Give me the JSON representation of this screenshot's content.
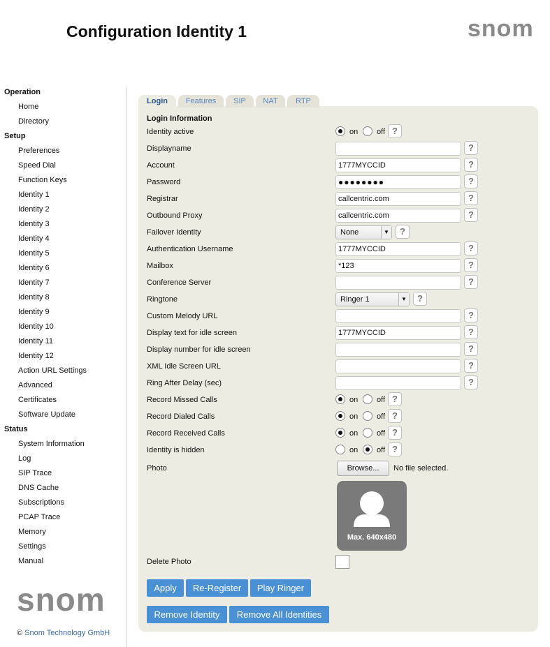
{
  "header": {
    "title": "Configuration Identity 1",
    "logo_text": "snom"
  },
  "sidebar": {
    "sections": [
      {
        "title": "Operation",
        "items": [
          "Home",
          "Directory"
        ]
      },
      {
        "title": "Setup",
        "items": [
          "Preferences",
          "Speed Dial",
          "Function Keys",
          "Identity 1",
          "Identity 2",
          "Identity 3",
          "Identity 4",
          "Identity 5",
          "Identity 6",
          "Identity 7",
          "Identity 8",
          "Identity 9",
          "Identity 10",
          "Identity 11",
          "Identity 12",
          "Action URL Settings",
          "Advanced",
          "Certificates",
          "Software Update"
        ]
      },
      {
        "title": "Status",
        "items": [
          "System Information",
          "Log",
          "SIP Trace",
          "DNS Cache",
          "Subscriptions",
          "PCAP Trace",
          "Memory",
          "Settings",
          "Manual"
        ]
      }
    ],
    "logo_text": "snom",
    "copyright_symbol": "©",
    "copyright_link": "Snom Technology GmbH"
  },
  "tabs": [
    "Login",
    "Features",
    "SIP",
    "NAT",
    "RTP"
  ],
  "form": {
    "section_title": "Login Information",
    "radio_on_label": "on",
    "radio_off_label": "off",
    "help_symbol": "?",
    "labels": {
      "identity_active": "Identity active",
      "displayname": "Displayname",
      "account": "Account",
      "password": "Password",
      "registrar": "Registrar",
      "outbound_proxy": "Outbound Proxy",
      "failover_identity": "Failover Identity",
      "auth_username": "Authentication Username",
      "mailbox": "Mailbox",
      "conference_server": "Conference Server",
      "ringtone": "Ringtone",
      "custom_melody_url": "Custom Melody URL",
      "display_text_idle": "Display text for idle screen",
      "display_number_idle": "Display number for idle screen",
      "xml_idle_url": "XML Idle Screen URL",
      "ring_after_delay": "Ring After Delay (sec)",
      "record_missed": "Record Missed Calls",
      "record_dialed": "Record Dialed Calls",
      "record_received": "Record Received Calls",
      "identity_hidden": "Identity is hidden",
      "photo": "Photo",
      "delete_photo": "Delete Photo"
    },
    "values": {
      "identity_active": "on",
      "displayname": "",
      "account": "1777MYCCID",
      "password": "●●●●●●●●",
      "registrar": "callcentric.com",
      "outbound_proxy": "callcentric.com",
      "failover_identity": "None",
      "auth_username": "1777MYCCID",
      "mailbox": "*123",
      "conference_server": "",
      "ringtone": "Ringer 1",
      "custom_melody_url": "",
      "display_text_idle": "1777MYCCID",
      "display_number_idle": "",
      "xml_idle_url": "",
      "ring_after_delay": "",
      "record_missed": "on",
      "record_dialed": "on",
      "record_received": "on",
      "identity_hidden": "off",
      "delete_photo": false
    },
    "photo": {
      "browse_label": "Browse...",
      "no_file_text": "No file selected.",
      "max_text": "Max. 640x480"
    }
  },
  "buttons": {
    "apply": "Apply",
    "reregister": "Re-Register",
    "play_ringer": "Play Ringer",
    "remove_identity": "Remove Identity",
    "remove_all": "Remove All Identities"
  },
  "colors": {
    "accent": "#4a90d4",
    "panel": "#edece2",
    "link": "#3d6ba6"
  }
}
